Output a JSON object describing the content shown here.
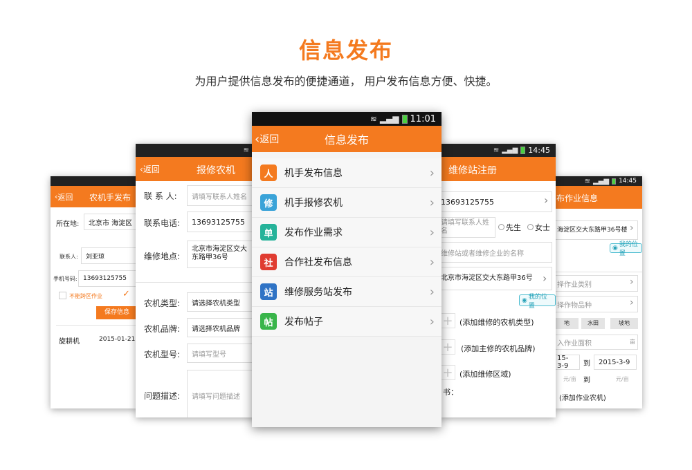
{
  "hero": {
    "title": "信息发布",
    "subtitle": "为用户提供信息发布的便捷通道， 用户发布信息方便、快捷。"
  },
  "colors": {
    "accent": "#f47a1f",
    "statusbar": "#222222",
    "location": "#2aa3b9"
  },
  "phone1": {
    "title": "农机手发布",
    "back": "返回",
    "location_label": "所在地:",
    "location_value": "北京市 海淀区",
    "contact_label": "联系人:",
    "contact_value": "刘亚琼",
    "phone_label": "手机号码:",
    "phone_value": "13693125755",
    "checkbox_label": "不能跨区作业",
    "save_button": "保存信息",
    "record_name": "旋耕机",
    "record_date": "2015-01-21"
  },
  "phone2": {
    "title": "报修农机",
    "back": "返回",
    "contact_label": "联 系 人:",
    "contact_placeholder": "请填写联系人姓名",
    "phone_label": "联系电话:",
    "phone_value": "13693125755",
    "address_label": "维修地点:",
    "address_value": "北京市海淀区交大东路甲36号",
    "type_label": "农机类型:",
    "type_value": "请选择农机类型",
    "brand_label": "农机品牌:",
    "brand_value": "请选择农机品牌",
    "model_label": "农机型号:",
    "model_placeholder": "请填写型号",
    "desc_label": "问题描述:",
    "desc_placeholder": "请填写问题描述"
  },
  "phone4": {
    "title": "维修站注册",
    "time": "14:45",
    "phone_value": "13693125755",
    "contact_placeholder": "请填写联系人姓名",
    "mr": "先生",
    "ms": "女士",
    "org_placeholder": "维修站或者维修企业的名称",
    "address_value": "北京市海淀区交大东路甲36号",
    "my_location": "我的位置",
    "add_type": "(添加维修的农机类型)",
    "add_brand": "(添加主修的农机品牌)",
    "add_region": "(添加维修区域)",
    "note_fragment": "书："
  },
  "phone3": {
    "title": "布作业信息",
    "time": "14:45",
    "address_value": "海淀区交大东路甲36号楼",
    "my_location": "我的位置",
    "work_type": "择作业类别",
    "crop_type": "择作物品种",
    "terrain": [
      "地",
      "水田",
      "坡地"
    ],
    "area_placeholder": "入作业面积",
    "area_unit": "亩",
    "date_from": "15-3-9",
    "date_to_label": "到",
    "date_to": "2015-3-9",
    "price_unit": "元/亩",
    "price_to_label": "到",
    "price_unit2": "元/亩",
    "add_machine": "(添加作业农机)"
  },
  "phone5": {
    "title": "信息发布",
    "back": "返回",
    "time": "11:01",
    "menu": [
      {
        "label": "机手发布信息",
        "icon": "driver-publish-icon",
        "color": "#f47a1f",
        "glyph": "人"
      },
      {
        "label": "机手报修农机",
        "icon": "repair-machine-icon",
        "color": "#3aa3d8",
        "glyph": "修"
      },
      {
        "label": "发布作业需求",
        "icon": "publish-demand-icon",
        "color": "#26b39a",
        "glyph": "单"
      },
      {
        "label": "合作社发布信息",
        "icon": "coop-publish-icon",
        "color": "#e03c31",
        "glyph": "社"
      },
      {
        "label": "维修服务站发布",
        "icon": "service-station-icon",
        "color": "#2f73c5",
        "glyph": "站"
      },
      {
        "label": "发布帖子",
        "icon": "post-icon",
        "color": "#39b54a",
        "glyph": "帖"
      }
    ]
  }
}
